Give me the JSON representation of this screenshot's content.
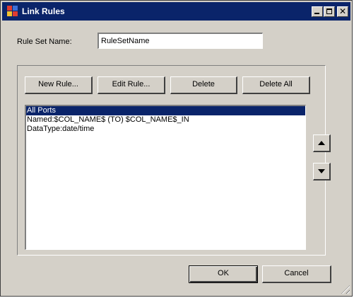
{
  "window": {
    "title": "Link Rules",
    "icon": "app-icon",
    "controls": [
      "minimize-icon",
      "maximize-icon",
      "close-icon"
    ]
  },
  "rule_set": {
    "label": "Rule Set Name:",
    "value": "RuleSetName"
  },
  "toolbar": {
    "new_rule": "New Rule...",
    "edit_rule": "Edit Rule...",
    "delete": "Delete",
    "delete_all": "Delete All"
  },
  "rules_list": {
    "items": [
      {
        "label": "All Ports",
        "selected": true
      },
      {
        "label": "Named:$COL_NAME$ (TO) $COL_NAME$_IN",
        "selected": false
      },
      {
        "label": "DataType:date/time",
        "selected": false
      }
    ]
  },
  "footer": {
    "ok": "OK",
    "cancel": "Cancel"
  },
  "colors": {
    "titlebar": "#0a246a",
    "face": "#d4d0c8",
    "selection": "#0a246a"
  }
}
